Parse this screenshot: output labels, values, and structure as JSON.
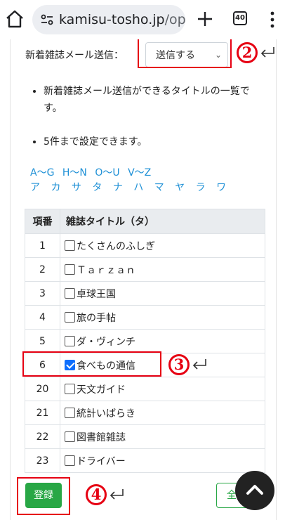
{
  "browser": {
    "url_main": "kamisu-tosho.jp",
    "url_dim": "/op",
    "tab_count": "40"
  },
  "form": {
    "send_label": "新着雑誌メール送信：",
    "send_select_value": "送信する",
    "bullets": [
      "新着雑誌メール送信ができるタイトルの一覧です。",
      "5件まで設定できます。"
    ],
    "alpha_links": [
      "A〜G",
      "H〜N",
      "O〜U",
      "V〜Z"
    ],
    "kana_links": [
      "ア",
      "カ",
      "サ",
      "タ",
      "ナ",
      "ハ",
      "マ",
      "ヤ",
      "ラ",
      "ワ"
    ],
    "table": {
      "headers": [
        "項番",
        "雑誌タイトル（タ）"
      ],
      "rows": [
        {
          "no": "1",
          "title": "たくさんのふしぎ",
          "checked": false
        },
        {
          "no": "2",
          "title": "Ｔａｒｚａｎ",
          "checked": false
        },
        {
          "no": "3",
          "title": "卓球王国",
          "checked": false
        },
        {
          "no": "4",
          "title": "旅の手帖",
          "checked": false
        },
        {
          "no": "5",
          "title": "ダ・ヴィンチ",
          "checked": false
        },
        {
          "no": "6",
          "title": "食べもの通信",
          "checked": true
        },
        {
          "no": "20",
          "title": "天文ガイド",
          "checked": false
        },
        {
          "no": "21",
          "title": "統計いばらき",
          "checked": false
        },
        {
          "no": "22",
          "title": "図書館雑誌",
          "checked": false
        },
        {
          "no": "23",
          "title": "ドライバー",
          "checked": false
        }
      ]
    },
    "register_label": "登録",
    "all_label": "全"
  },
  "annotations": {
    "mark2": "2",
    "mark3": "3",
    "mark4": "4",
    "color": "#e60012"
  },
  "colors": {
    "accent_green": "#28a745",
    "link_blue": "#1e90d6",
    "checkbox_blue": "#0d6efd"
  }
}
